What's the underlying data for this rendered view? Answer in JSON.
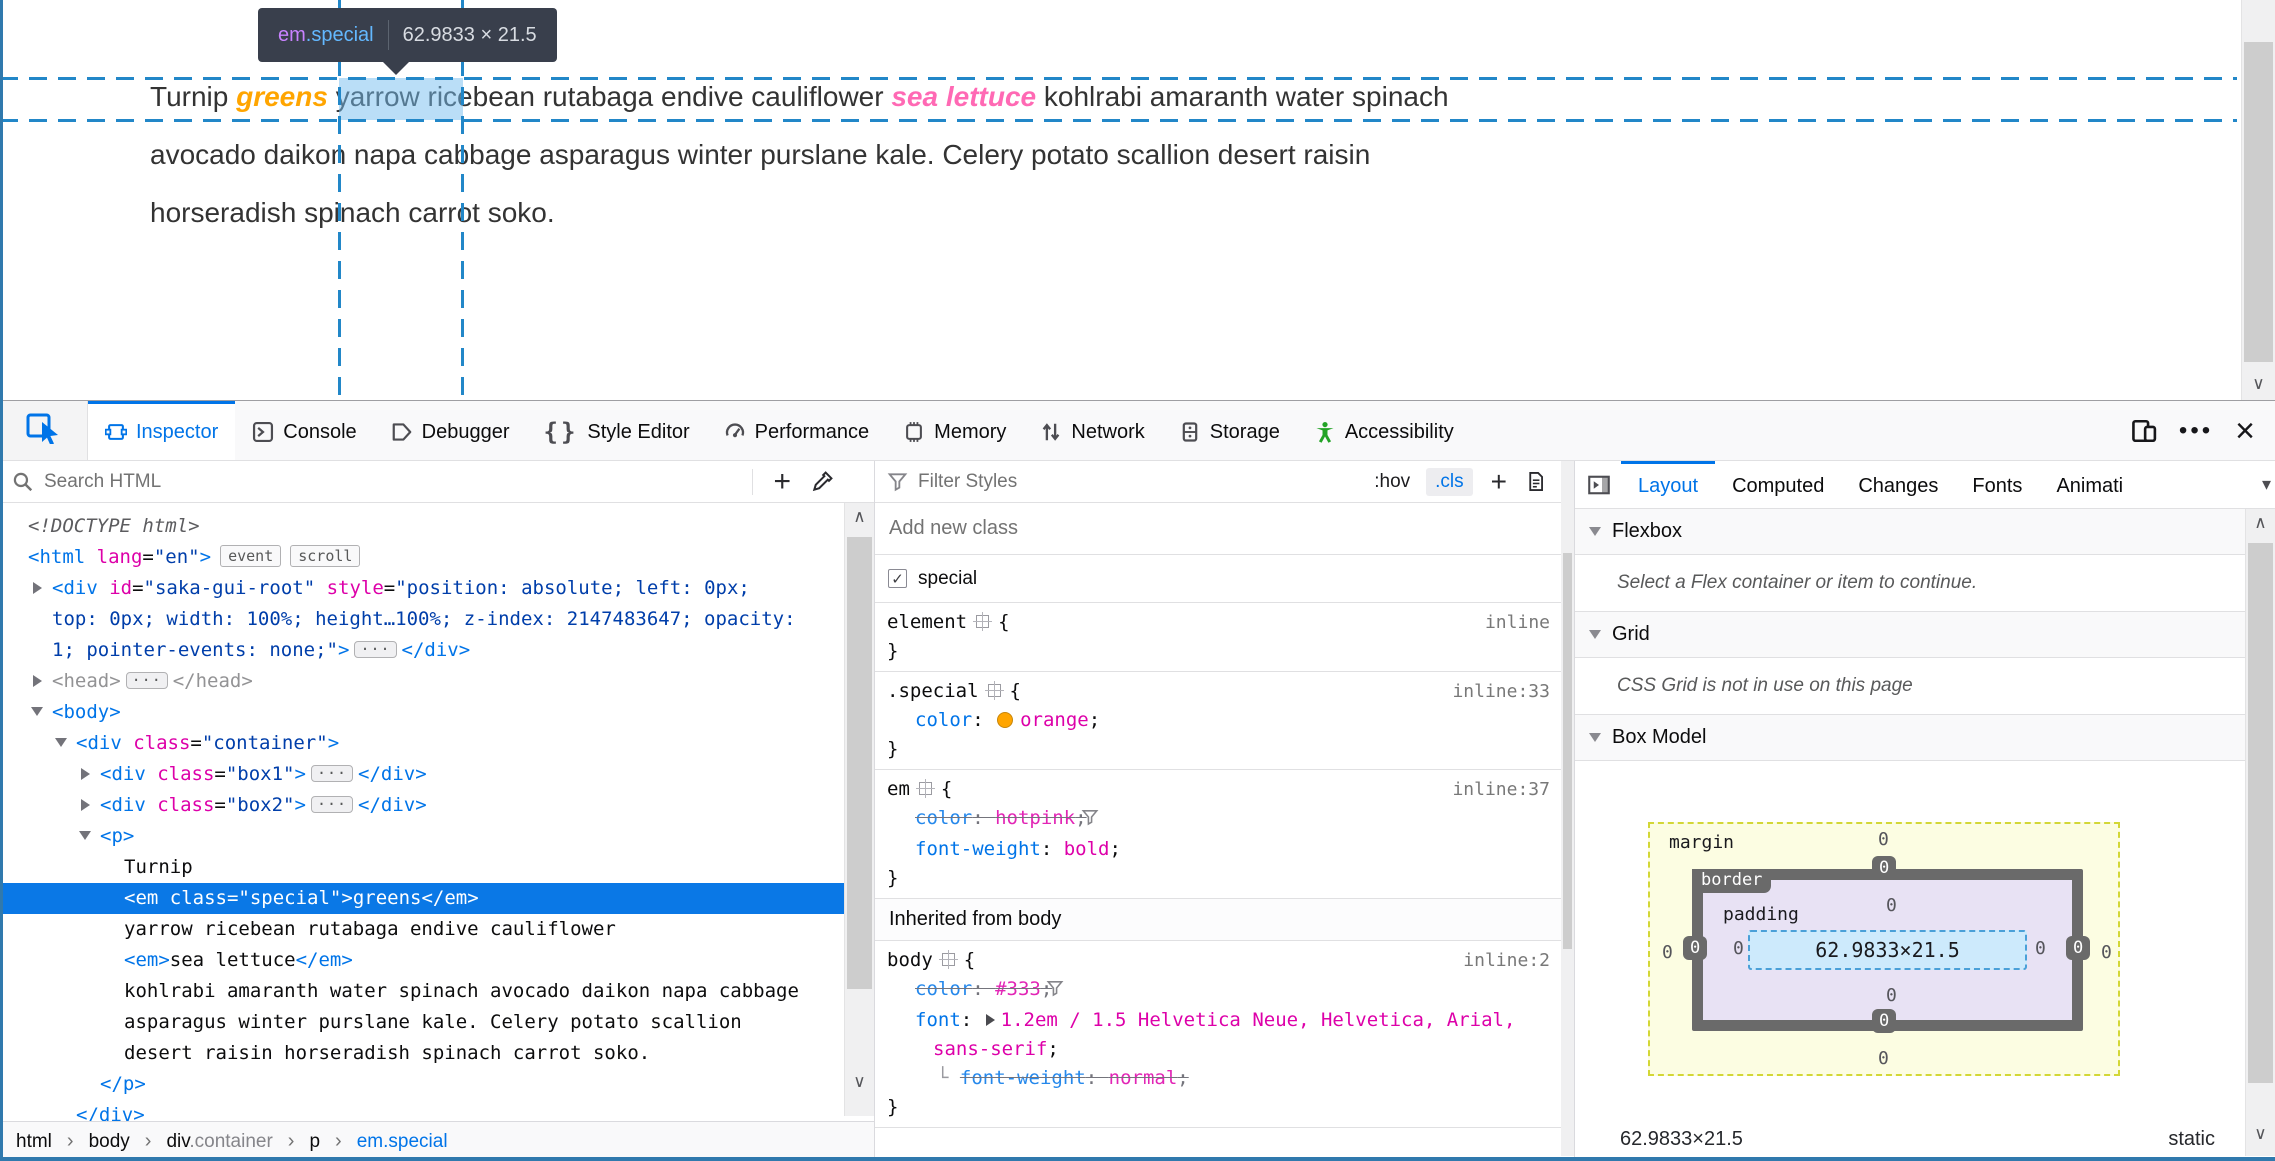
{
  "page": {
    "infobar": {
      "tag": "em",
      "class": ".special",
      "dimensions": "62.9833 × 21.5"
    },
    "paragraph": {
      "segments": [
        {
          "text": "Turnip ",
          "style": "plain"
        },
        {
          "text": "greens",
          "style": "special"
        },
        {
          "text": " yarrow ricebean rutabaga endive cauliflower ",
          "style": "plain"
        },
        {
          "text": "sea lettuce",
          "style": "em"
        },
        {
          "text": " kohlrabi amaranth water spinach\navocado daikon napa cabbage asparagus winter purslane kale. Celery potato scallion desert raisin\nhorseradish spinach carrot soko.",
          "style": "plain"
        }
      ]
    }
  },
  "colors": {
    "accent": "#0074e8",
    "selected_row": "#0a78e6",
    "guide": "#2287c8",
    "highlight_fill": "rgba(117,190,240,0.5)",
    "special_orange": "#ffa500",
    "em_hotpink": "#ff69b4",
    "infobar_bg": "#393f4c",
    "accessibility_green": "#23a326"
  },
  "devtools": {
    "toolbar": {
      "picker": {
        "icon": "picker-icon"
      },
      "tabs": [
        {
          "label": "Inspector",
          "icon": "inspector-icon",
          "active": true
        },
        {
          "label": "Console",
          "icon": "console-icon"
        },
        {
          "label": "Debugger",
          "icon": "debugger-icon"
        },
        {
          "label": "Style Editor",
          "icon": "style-editor-icon"
        },
        {
          "label": "Performance",
          "icon": "performance-icon"
        },
        {
          "label": "Memory",
          "icon": "memory-icon"
        },
        {
          "label": "Network",
          "icon": "network-icon"
        },
        {
          "label": "Storage",
          "icon": "storage-icon"
        },
        {
          "label": "Accessibility",
          "icon": "accessibility-icon",
          "green": true
        }
      ],
      "right": [
        {
          "icon": "responsive-mode-icon"
        },
        {
          "icon": "meatball-menu-icon"
        },
        {
          "icon": "close-icon"
        }
      ]
    }
  },
  "markup": {
    "search_placeholder": "Search HTML",
    "tree": [
      {
        "indent": 0,
        "tokens": [
          {
            "c": "doctype",
            "v": "<!DOCTYPE html>"
          }
        ]
      },
      {
        "indent": 0,
        "tokens": [
          {
            "c": "tag",
            "v": "<html"
          },
          {
            "c": "attr",
            "v": " lang"
          },
          {
            "c": "plain",
            "v": "="
          },
          {
            "c": "val",
            "v": "\"en\""
          },
          {
            "c": "tag",
            "v": ">"
          },
          {
            "c": "badge",
            "v": "event"
          },
          {
            "c": "badge",
            "v": "scroll"
          }
        ]
      },
      {
        "indent": 1,
        "twisty": "closed",
        "tokens": [
          {
            "c": "tag",
            "v": "<div"
          },
          {
            "c": "attr",
            "v": " id"
          },
          {
            "c": "plain",
            "v": "="
          },
          {
            "c": "val",
            "v": "\"saka-gui-root\""
          },
          {
            "c": "attr",
            "v": " style"
          },
          {
            "c": "plain",
            "v": "="
          },
          {
            "c": "val",
            "v": "\"position: absolute; left: 0px;"
          }
        ]
      },
      {
        "indent": 1,
        "cont": true,
        "tokens": [
          {
            "c": "val",
            "v": "top: 0px; width: 100%; height…100%; z-index: 2147483647; opacity:"
          }
        ]
      },
      {
        "indent": 1,
        "cont": true,
        "tokens": [
          {
            "c": "val",
            "v": "1; pointer-events: none;\""
          },
          {
            "c": "tag",
            "v": ">"
          },
          {
            "c": "ell"
          },
          {
            "c": "tag",
            "v": "</div>"
          }
        ]
      },
      {
        "indent": 1,
        "twisty": "closed",
        "tokens": [
          {
            "c": "g",
            "v": "<head>"
          },
          {
            "c": "ell"
          },
          {
            "c": "g",
            "v": "</head>"
          }
        ]
      },
      {
        "indent": 1,
        "twisty": "open",
        "tokens": [
          {
            "c": "tag",
            "v": "<body>"
          }
        ]
      },
      {
        "indent": 2,
        "twisty": "open",
        "tokens": [
          {
            "c": "tag",
            "v": "<div"
          },
          {
            "c": "attr",
            "v": " class"
          },
          {
            "c": "plain",
            "v": "="
          },
          {
            "c": "val",
            "v": "\"container\""
          },
          {
            "c": "tag",
            "v": ">"
          }
        ]
      },
      {
        "indent": 3,
        "twisty": "closed",
        "tokens": [
          {
            "c": "tag",
            "v": "<div"
          },
          {
            "c": "attr",
            "v": " class"
          },
          {
            "c": "plain",
            "v": "="
          },
          {
            "c": "val",
            "v": "\"box1\""
          },
          {
            "c": "tag",
            "v": ">"
          },
          {
            "c": "ell"
          },
          {
            "c": "tag",
            "v": "</div>"
          }
        ]
      },
      {
        "indent": 3,
        "twisty": "closed",
        "tokens": [
          {
            "c": "tag",
            "v": "<div"
          },
          {
            "c": "attr",
            "v": " class"
          },
          {
            "c": "plain",
            "v": "="
          },
          {
            "c": "val",
            "v": "\"box2\""
          },
          {
            "c": "tag",
            "v": ">"
          },
          {
            "c": "ell"
          },
          {
            "c": "tag",
            "v": "</div>"
          }
        ]
      },
      {
        "indent": 3,
        "twisty": "open",
        "tokens": [
          {
            "c": "tag",
            "v": "<p>"
          }
        ]
      },
      {
        "indent": 4,
        "tokens": [
          {
            "c": "text",
            "v": "Turnip"
          }
        ]
      },
      {
        "indent": 4,
        "selected": true,
        "tokens": [
          {
            "c": "tag",
            "v": "<em"
          },
          {
            "c": "attr",
            "v": " class"
          },
          {
            "c": "plain",
            "v": "="
          },
          {
            "c": "val",
            "v": "\"special\""
          },
          {
            "c": "tag",
            "v": ">"
          },
          {
            "c": "text",
            "v": "greens"
          },
          {
            "c": "tag",
            "v": "</em>"
          }
        ]
      },
      {
        "indent": 4,
        "tokens": [
          {
            "c": "text",
            "v": "yarrow ricebean rutabaga endive cauliflower"
          }
        ]
      },
      {
        "indent": 4,
        "tokens": [
          {
            "c": "tag",
            "v": "<em>"
          },
          {
            "c": "text",
            "v": "sea lettuce"
          },
          {
            "c": "tag",
            "v": "</em>"
          }
        ]
      },
      {
        "indent": 4,
        "tokens": [
          {
            "c": "text",
            "v": "kohlrabi amaranth water spinach avocado daikon napa cabbage"
          }
        ]
      },
      {
        "indent": 4,
        "cont": true,
        "tokens": [
          {
            "c": "text",
            "v": "asparagus winter purslane kale. Celery potato scallion"
          }
        ]
      },
      {
        "indent": 4,
        "cont": true,
        "tokens": [
          {
            "c": "text",
            "v": "desert raisin horseradish spinach carrot soko."
          }
        ]
      },
      {
        "indent": 3,
        "tokens": [
          {
            "c": "tag",
            "v": "</p>"
          }
        ]
      },
      {
        "indent": 2,
        "tokens": [
          {
            "c": "tag",
            "v": "</div>"
          }
        ]
      }
    ],
    "breadcrumbs": [
      {
        "text": "html"
      },
      {
        "text": "body"
      },
      {
        "text": "div",
        "suffix": ".container"
      },
      {
        "text": "p"
      },
      {
        "text": "em",
        "suffix": ".special",
        "selected": true
      }
    ]
  },
  "rules": {
    "filter_placeholder": "Filter Styles",
    "hov_label": ":hov",
    "cls_label": ".cls",
    "add_class_placeholder": "Add new class",
    "class_toggle": {
      "label": "special",
      "checked": true
    },
    "sections": [
      {
        "type": "rule",
        "selector": "element",
        "loc": "inline",
        "decls": []
      },
      {
        "type": "rule",
        "selector": ".special",
        "loc": "inline:33",
        "decls": [
          {
            "prop": "color",
            "value": "orange",
            "swatch": "#ffa500"
          }
        ]
      },
      {
        "type": "rule",
        "selector": "em",
        "loc": "inline:37",
        "decls": [
          {
            "prop": "color",
            "value": "hotpink",
            "struck": true,
            "funnel": true
          },
          {
            "prop": "font-weight",
            "value": "bold"
          }
        ]
      },
      {
        "type": "header",
        "label": "Inherited from body"
      },
      {
        "type": "rule",
        "selector": "body",
        "loc": "inline:2",
        "decls": [
          {
            "prop": "color",
            "value": "#333",
            "struck": true,
            "funnel": true
          },
          {
            "prop": "font",
            "value": "1.2em / 1.5 Helvetica Neue, Helvetica, Arial, sans-serif",
            "twisty": true
          },
          {
            "prop": "font-weight",
            "value": "normal",
            "struck": true,
            "sub": true
          }
        ]
      }
    ]
  },
  "layout": {
    "tabs": [
      {
        "label": "Layout",
        "active": true
      },
      {
        "label": "Computed"
      },
      {
        "label": "Changes"
      },
      {
        "label": "Fonts"
      },
      {
        "label": "Animati"
      }
    ],
    "flexbox": {
      "title": "Flexbox",
      "message": "Select a Flex container or item to continue."
    },
    "grid": {
      "title": "Grid",
      "message": "CSS Grid is not in use on this page"
    },
    "box_model": {
      "title": "Box Model",
      "labels": {
        "margin": "margin",
        "border": "border",
        "padding": "padding"
      },
      "content": "62.9833×21.5",
      "values": {
        "margin_top": "0",
        "margin_right": "0",
        "margin_bottom": "0",
        "margin_left": "0",
        "border_top": "0",
        "border_right": "0",
        "border_bottom": "0",
        "border_left": "0",
        "padding_top": "0",
        "padding_right": "0",
        "padding_bottom": "0",
        "padding_left": "0"
      },
      "footer_dimensions": "62.9833×21.5",
      "footer_position": "static"
    }
  }
}
